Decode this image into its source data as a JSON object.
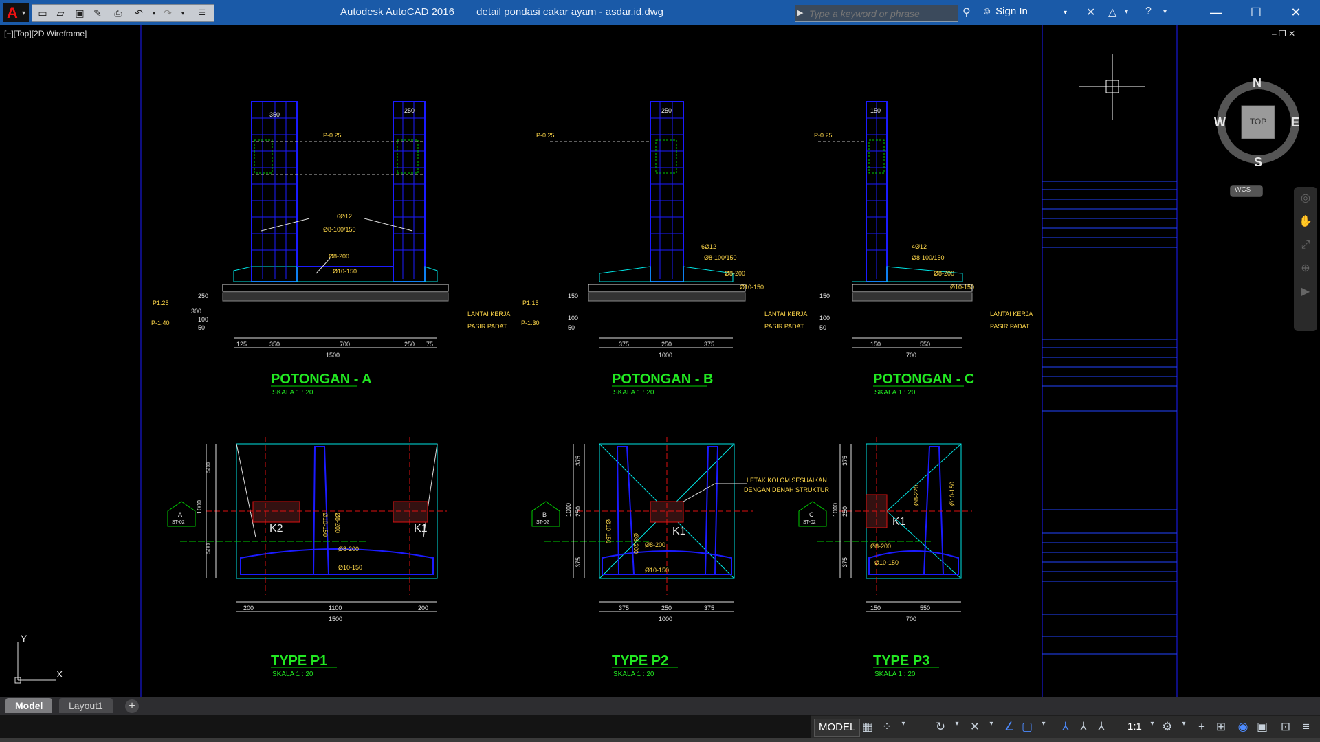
{
  "app": {
    "title": "Autodesk AutoCAD 2016",
    "document": "detail pondasi cakar ayam - asdar.id.dwg"
  },
  "search": {
    "placeholder": "Type a keyword or phrase"
  },
  "user": {
    "sign_in": "Sign In"
  },
  "viewport": {
    "label": "[−][Top][2D Wireframe]",
    "controls": "‒ ❐ ✕"
  },
  "viewcube": {
    "n": "N",
    "s": "S",
    "e": "E",
    "w": "W",
    "top": "TOP",
    "wcs": "WCS"
  },
  "ucs": {
    "x": "X",
    "y": "Y"
  },
  "tabs": [
    "Model",
    "Layout1"
  ],
  "status": {
    "model": "MODEL",
    "scale": "1:1"
  },
  "drawing": {
    "sections": [
      {
        "title": "POTONGAN - A",
        "scale": "SKALA 1 : 20",
        "top_dims": [
          "350",
          "250"
        ],
        "level_top": "P-0.25",
        "notes": [
          "6Ø12",
          "Ø8-100/150",
          "Ø8-200",
          "Ø10-150"
        ],
        "levels": [
          "P1.25",
          "P-1.40"
        ],
        "side_dims": [
          "300",
          "250",
          "100",
          "50"
        ],
        "layers": [
          "LANTAI KERJA",
          "PASIR PADAT"
        ],
        "bottom_dims": [
          "125",
          "350",
          "700",
          "250",
          "75"
        ],
        "total": "1500"
      },
      {
        "title": "POTONGAN - B",
        "scale": "SKALA 1 : 20",
        "top_dims": [
          "250"
        ],
        "level_top": "P-0.25",
        "notes": [
          "6Ø12",
          "Ø8-100/150",
          "Ø8-200",
          "Ø10-150"
        ],
        "levels": [
          "P1.15",
          "P-1.30"
        ],
        "side_dims": [
          "150",
          "100",
          "50"
        ],
        "layers": [
          "LANTAI KERJA",
          "PASIR PADAT"
        ],
        "bottom_dims": [
          "375",
          "250",
          "375"
        ],
        "total": "1000"
      },
      {
        "title": "POTONGAN - C",
        "scale": "SKALA 1 : 20",
        "top_dims": [
          "150"
        ],
        "level_top": "P-0.25",
        "notes": [
          "4Ø12",
          "Ø8-100/150",
          "Ø8-200",
          "Ø10-150"
        ],
        "levels": [],
        "side_dims": [
          "150",
          "100",
          "50"
        ],
        "layers": [
          "LANTAI KERJA",
          "PASIR PADAT"
        ],
        "bottom_dims": [
          "150",
          "550"
        ],
        "total": "700"
      }
    ],
    "plans": [
      {
        "title": "TYPE P1",
        "scale": "SKALA 1 : 20",
        "marker": "A",
        "sheet": "ST-02",
        "labels": [
          "K2",
          "K1"
        ],
        "notes": [
          "Ø10-150",
          "Ø8-200",
          "Ø8-200",
          "Ø10-150"
        ],
        "side_dims": [
          "500",
          "1000",
          "500"
        ],
        "bottom_dims": [
          "200",
          "1100",
          "200"
        ],
        "total": "1500"
      },
      {
        "title": "TYPE P2",
        "scale": "SKALA 1 : 20",
        "marker": "B",
        "sheet": "ST-02",
        "labels": [
          "K1"
        ],
        "notes": [
          "Ø10-150",
          "Ø8-200",
          "Ø8-200",
          "Ø10-150"
        ],
        "callout": [
          "LETAK KOLOM SESUAIKAN",
          "DENGAN DENAH STRUKTUR"
        ],
        "side_dims": [
          "375",
          "1000",
          "250",
          "375"
        ],
        "bottom_dims": [
          "375",
          "250",
          "375"
        ],
        "total": "1000"
      },
      {
        "title": "TYPE P3",
        "scale": "SKALA 1 : 20",
        "marker": "C",
        "sheet": "ST-02",
        "labels": [
          "K1"
        ],
        "notes": [
          "Ø8-220",
          "Ø10-150",
          "Ø8-200",
          "Ø10-150"
        ],
        "side_dims": [
          "375",
          "1000",
          "250",
          "375"
        ],
        "bottom_dims": [
          "150",
          "550"
        ],
        "total": "700"
      }
    ]
  }
}
